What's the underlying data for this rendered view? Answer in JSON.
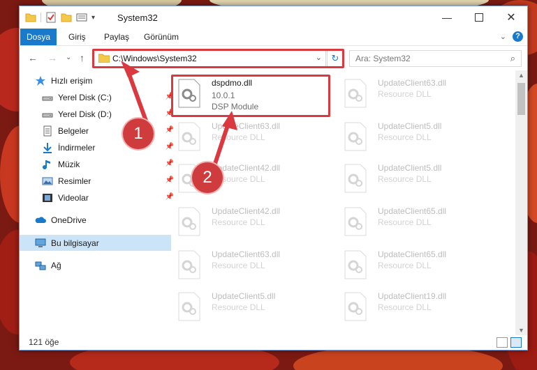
{
  "window": {
    "title": "System32"
  },
  "ribbon": {
    "tabs": [
      {
        "label": "Dosya"
      },
      {
        "label": "Giriş"
      },
      {
        "label": "Paylaş"
      },
      {
        "label": "Görünüm"
      }
    ],
    "help": "?"
  },
  "address": {
    "path": "C:\\Windows\\System32",
    "search_placeholder": "Ara: System32"
  },
  "nav": {
    "items": [
      {
        "label": "Hızlı erişim"
      },
      {
        "label": "Yerel Disk (C:)"
      },
      {
        "label": "Yerel Disk (D:)"
      },
      {
        "label": "Belgeler"
      },
      {
        "label": "İndirmeler"
      },
      {
        "label": "Müzik"
      },
      {
        "label": "Resimler"
      },
      {
        "label": "Videolar"
      },
      {
        "label": "OneDrive"
      },
      {
        "label": "Bu bilgisayar"
      },
      {
        "label": "Ağ"
      }
    ]
  },
  "files": [
    {
      "name": "dspdmo.dll",
      "version": "10.0.1",
      "description": "DSP Module"
    },
    {
      "name": "UpdateClient63.dll",
      "version": "",
      "description": "Resource DLL"
    },
    {
      "name": "UpdateClient63.dll",
      "version": "",
      "description": "Resource DLL"
    },
    {
      "name": "UpdateClient5.dll",
      "version": "",
      "description": "Resource DLL"
    },
    {
      "name": "UpdateClient42.dll",
      "version": "",
      "description": "Resource DLL"
    },
    {
      "name": "UpdateClient5.dll",
      "version": "",
      "description": "Resource DLL"
    },
    {
      "name": "UpdateClient42.dll",
      "version": "",
      "description": "Resource DLL"
    },
    {
      "name": "UpdateClient65.dll",
      "version": "",
      "description": "Resource DLL"
    },
    {
      "name": "UpdateClient63.dll",
      "version": "",
      "description": "Resource DLL"
    },
    {
      "name": "UpdateClient65.dll",
      "version": "",
      "description": "Resource DLL"
    },
    {
      "name": "UpdateClient5.dll",
      "version": "",
      "description": "Resource DLL"
    },
    {
      "name": "UpdateClient19.dll",
      "version": "",
      "description": "Resource DLL"
    }
  ],
  "status": {
    "item_count": "121 öğe"
  },
  "callouts": [
    {
      "number": "1"
    },
    {
      "number": "2"
    }
  ],
  "colors": {
    "accent": "#1979ca",
    "callout": "#d9393f",
    "selection": "#cce4f7"
  }
}
